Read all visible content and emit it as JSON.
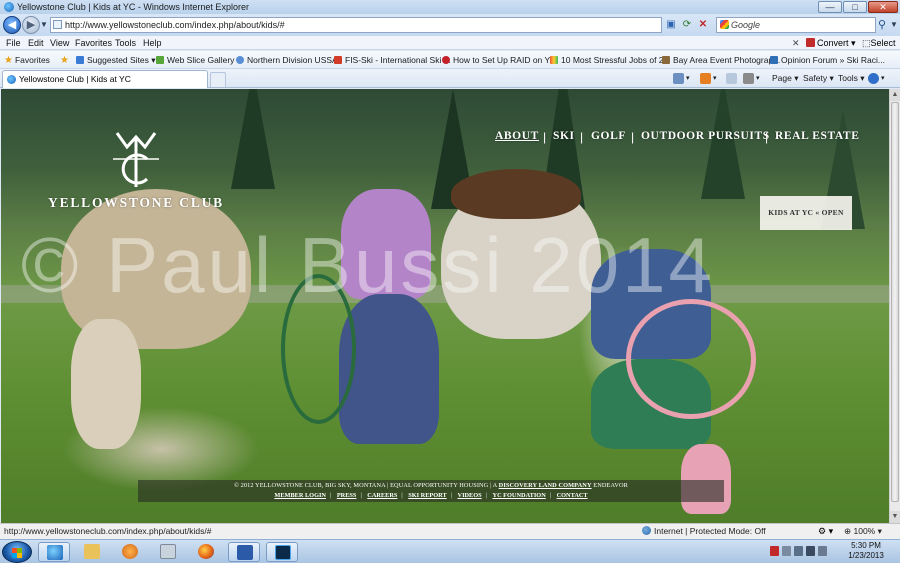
{
  "window": {
    "title": "Yellowstone Club | Kids at YC - Windows Internet Explorer",
    "min": "—",
    "max": "□",
    "close": "✕"
  },
  "address": {
    "url": "http://www.yellowstoneclub.com/index.php/about/kids/#",
    "search_placeholder": "Google"
  },
  "menu": {
    "items": [
      "File",
      "Edit",
      "View",
      "Favorites",
      "Tools",
      "Help"
    ],
    "convert": "Convert",
    "select": "Select"
  },
  "favorites": {
    "label": "Favorites",
    "items": [
      "Suggested Sites",
      "Web Slice Gallery",
      "Northern Division USSA",
      "FIS-Ski - International Ski ...",
      "How to Set Up RAID on Y...",
      "10 Most Stressful Jobs of 2...",
      "Bay Area Event Photograp...",
      "Opinion Forum » Ski Raci..."
    ]
  },
  "tab": {
    "title": "Yellowstone Club | Kids at YC"
  },
  "command": {
    "page": "Page",
    "safety": "Safety",
    "tools": "Tools"
  },
  "site": {
    "logo_text": "YELLOWSTONE CLUB",
    "nav": [
      "ABOUT",
      "SKI",
      "GOLF",
      "OUTDOOR PURSUITS",
      "REAL ESTATE"
    ],
    "kids_panel": "KIDS AT YC « OPEN",
    "watermark": "© Paul Bussi 2014",
    "footer": {
      "copyright_before": "© 2012 YELLOWSTONE CLUB, BIG SKY, MONTANA  |  EQUAL OPPORTUNITY HOUSING  |  A",
      "discovery_link": "DISCOVERY LAND COMPANY",
      "copyright_after": "ENDEAVOR",
      "links": [
        "MEMBER LOGIN",
        "PRESS",
        "CAREERS",
        "SKI REPORT",
        "VIDEOS",
        "YC FOUNDATION",
        "CONTACT"
      ]
    }
  },
  "status": {
    "url": "http://www.yellowstoneclub.com/index.php/about/kids/#",
    "zone": "Internet | Protected Mode: Off",
    "zoom": "100%"
  },
  "taskbar": {
    "time": "5:30 PM",
    "date": "1/23/2013"
  }
}
